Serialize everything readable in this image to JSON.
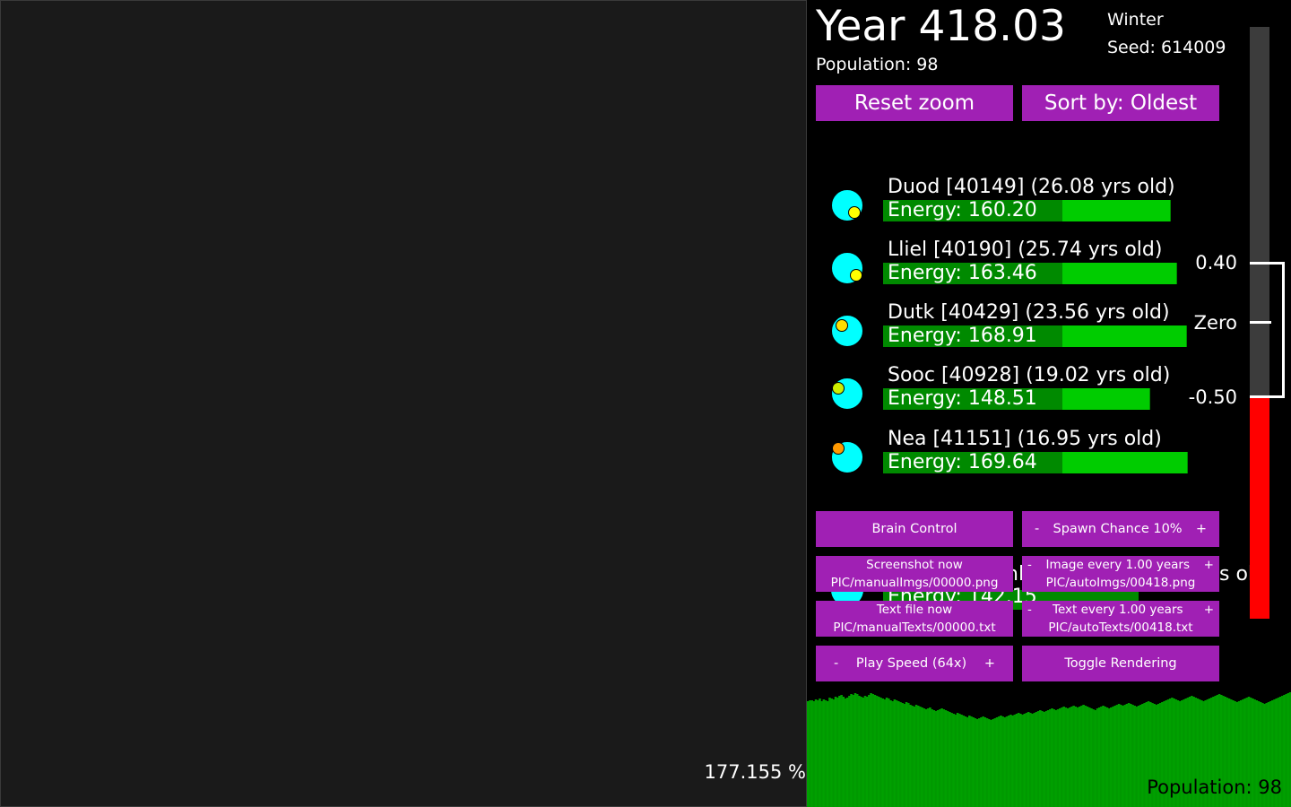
{
  "zoom_percent": "177.155 %",
  "header": {
    "year": "Year 418.03",
    "season": "Winter",
    "seed": "Seed: 614009",
    "population": "Population: 98"
  },
  "top_buttons": {
    "reset_zoom": "Reset zoom",
    "sort_by": "Sort by: Oldest"
  },
  "creatures": [
    {
      "name": "Duod [40149] (26.08 yrs old)",
      "energy": "Energy: 160.20",
      "energy_value": 160.2,
      "mouth_color": "#ffff00"
    },
    {
      "name": "Lliel [40190] (25.74 yrs old)",
      "energy": "Energy: 163.46",
      "energy_value": 163.46,
      "mouth_color": "#ffff00"
    },
    {
      "name": "Dutk [40429] (23.56 yrs old)",
      "energy": "Energy: 168.91",
      "energy_value": 168.91,
      "mouth_color": "#ffdd00"
    },
    {
      "name": "Sooc [40928] (19.02 yrs old)",
      "energy": "Energy: 148.51",
      "energy_value": 148.51,
      "mouth_color": "#ccee00"
    },
    {
      "name": "Nea [41151] (16.95 yrs old)",
      "energy": "Energy: 169.64",
      "energy_value": 169.64,
      "mouth_color": "#ff9900"
    }
  ],
  "ghost_creature": {
    "name_fragment_left": "nl",
    "name_fragment_right": "s ol)",
    "energy": "Energy: 142.15"
  },
  "controls": {
    "brain_control": "Brain Control",
    "spawn_minus": "-",
    "spawn_label": "Spawn Chance 10%",
    "spawn_plus": "+",
    "screenshot_line1": "Screenshot now",
    "screenshot_line2": "PIC/manualImgs/00000.png",
    "image_minus": "-",
    "image_label": "Image every 1.00 years",
    "image_plus": "+",
    "image_line2": "PIC/autoImgs/00418.png",
    "textfile_line1": "Text file now",
    "textfile_line2": "PIC/manualTexts/00000.txt",
    "text_minus": "-",
    "text_label": "Text every 1.00 years",
    "text_plus": "+",
    "text_line2": "PIC/autoTexts/00418.txt",
    "speed_minus": "-",
    "speed_label": "Play Speed (64x)",
    "speed_plus": "+",
    "toggle_rendering": "Toggle Rendering"
  },
  "thermometer": {
    "max_label": "0.40",
    "zero_label": "Zero",
    "min_label": "-0.50",
    "fill_fraction": 0.375,
    "fill_color": "#ff0000"
  },
  "population_chart": {
    "footer": "Population: 98",
    "bar_color": "#009900",
    "values": [
      118,
      119,
      119,
      118,
      120,
      119,
      121,
      118,
      120,
      119,
      118,
      122,
      121,
      120,
      123,
      122,
      124,
      125,
      123,
      121,
      122,
      124,
      126,
      125,
      127,
      126,
      124,
      123,
      122,
      124,
      123,
      125,
      127,
      126,
      125,
      124,
      123,
      122,
      121,
      120,
      122,
      121,
      119,
      118,
      120,
      119,
      118,
      117,
      116,
      115,
      117,
      116,
      114,
      113,
      112,
      114,
      113,
      112,
      111,
      110,
      109,
      110,
      111,
      109,
      108,
      107,
      108,
      109,
      110,
      109,
      108,
      107,
      106,
      105,
      104,
      103,
      105,
      104,
      103,
      102,
      101,
      100,
      102,
      101,
      100,
      99,
      98,
      99,
      100,
      101,
      100,
      99,
      98,
      97,
      98,
      99,
      100,
      101,
      102,
      101,
      100,
      101,
      102,
      103,
      102,
      103,
      104,
      105,
      104,
      103,
      104,
      105,
      106,
      105,
      104,
      105,
      106,
      107,
      108,
      107,
      106,
      107,
      108,
      109,
      110,
      109,
      108,
      109,
      110,
      111,
      112,
      111,
      110,
      111,
      112,
      113,
      112,
      111,
      112,
      113,
      114,
      113,
      112,
      111,
      110,
      109,
      108,
      110,
      111,
      112,
      113,
      112,
      111,
      110,
      111,
      112,
      113,
      114,
      115,
      114,
      113,
      114,
      115,
      116,
      115,
      114,
      113,
      112,
      113,
      114,
      115,
      116,
      117,
      118,
      117,
      116,
      115,
      114,
      115,
      116,
      117,
      118,
      119,
      120,
      121,
      122,
      121,
      120,
      119,
      118,
      119,
      120,
      121,
      122,
      123,
      124,
      123,
      122,
      121,
      120,
      119,
      118,
      119,
      120,
      121,
      122,
      123,
      124,
      125,
      126,
      125,
      124,
      123,
      122,
      121,
      120,
      119,
      118,
      117,
      118,
      119,
      120,
      121,
      122,
      123,
      122,
      121,
      120,
      119,
      118,
      117,
      116,
      115,
      116,
      117,
      118,
      119,
      120,
      121,
      122,
      123,
      124,
      125,
      126,
      127,
      128
    ]
  }
}
